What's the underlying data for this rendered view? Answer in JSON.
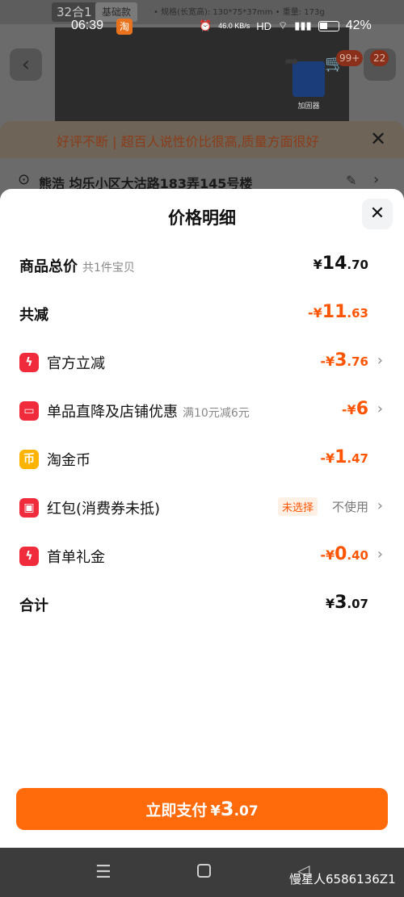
{
  "background": {
    "tag_combo": "32合1",
    "tag_basic": "基础款",
    "spec": "• 规格(长宽高): 130*75*37mm  • 重量: 173g",
    "box_label": "加固器",
    "cart_badge": "99+",
    "count_badge": "22",
    "notice": "好评不断 | 超百人说性价比很高,质量方面很好",
    "address": "熊浩  均乐小区大沽路183弄145号楼"
  },
  "status_bar": {
    "time": "06:39",
    "net_speed": "46.0 KB/s",
    "hd": "HD",
    "battery_pct": "42%"
  },
  "sheet": {
    "title": "价格明细",
    "rows": {
      "total": {
        "label": "商品总价",
        "sub": "共1件宝贝",
        "currency": "¥",
        "int": "14",
        "dec": ".70"
      },
      "reduce": {
        "label": "共减",
        "currency": "-¥",
        "int": "11",
        "dec": ".63"
      },
      "official": {
        "label": "官方立减",
        "currency": "-¥",
        "int": "3",
        "dec": ".76"
      },
      "shop": {
        "label": "单品直降及店铺优惠",
        "sub": "满10元减6元",
        "currency": "-¥",
        "int": "6",
        "dec": ""
      },
      "coin": {
        "label": "淘金币",
        "currency": "-¥",
        "int": "1",
        "dec": ".47"
      },
      "redpacket": {
        "label": "红包(消费券未抵)",
        "tag": "未选择",
        "value": "不使用"
      },
      "firstorder": {
        "label": "首单礼金",
        "currency": "-¥",
        "int": "0",
        "dec": ".40"
      },
      "sum": {
        "label": "合计",
        "currency": "¥",
        "int": "3",
        "dec": ".07"
      }
    },
    "pay": {
      "label": "立即支付",
      "currency": "¥",
      "int": "3",
      "dec": ".07"
    }
  },
  "navbar": {
    "watermark": "慢星人6586136Z1"
  },
  "colors": {
    "accent": "#ff5500",
    "pay_button": "#ff6a0a",
    "icon_red": "#f02c3c",
    "icon_yellow": "#ffb400"
  }
}
